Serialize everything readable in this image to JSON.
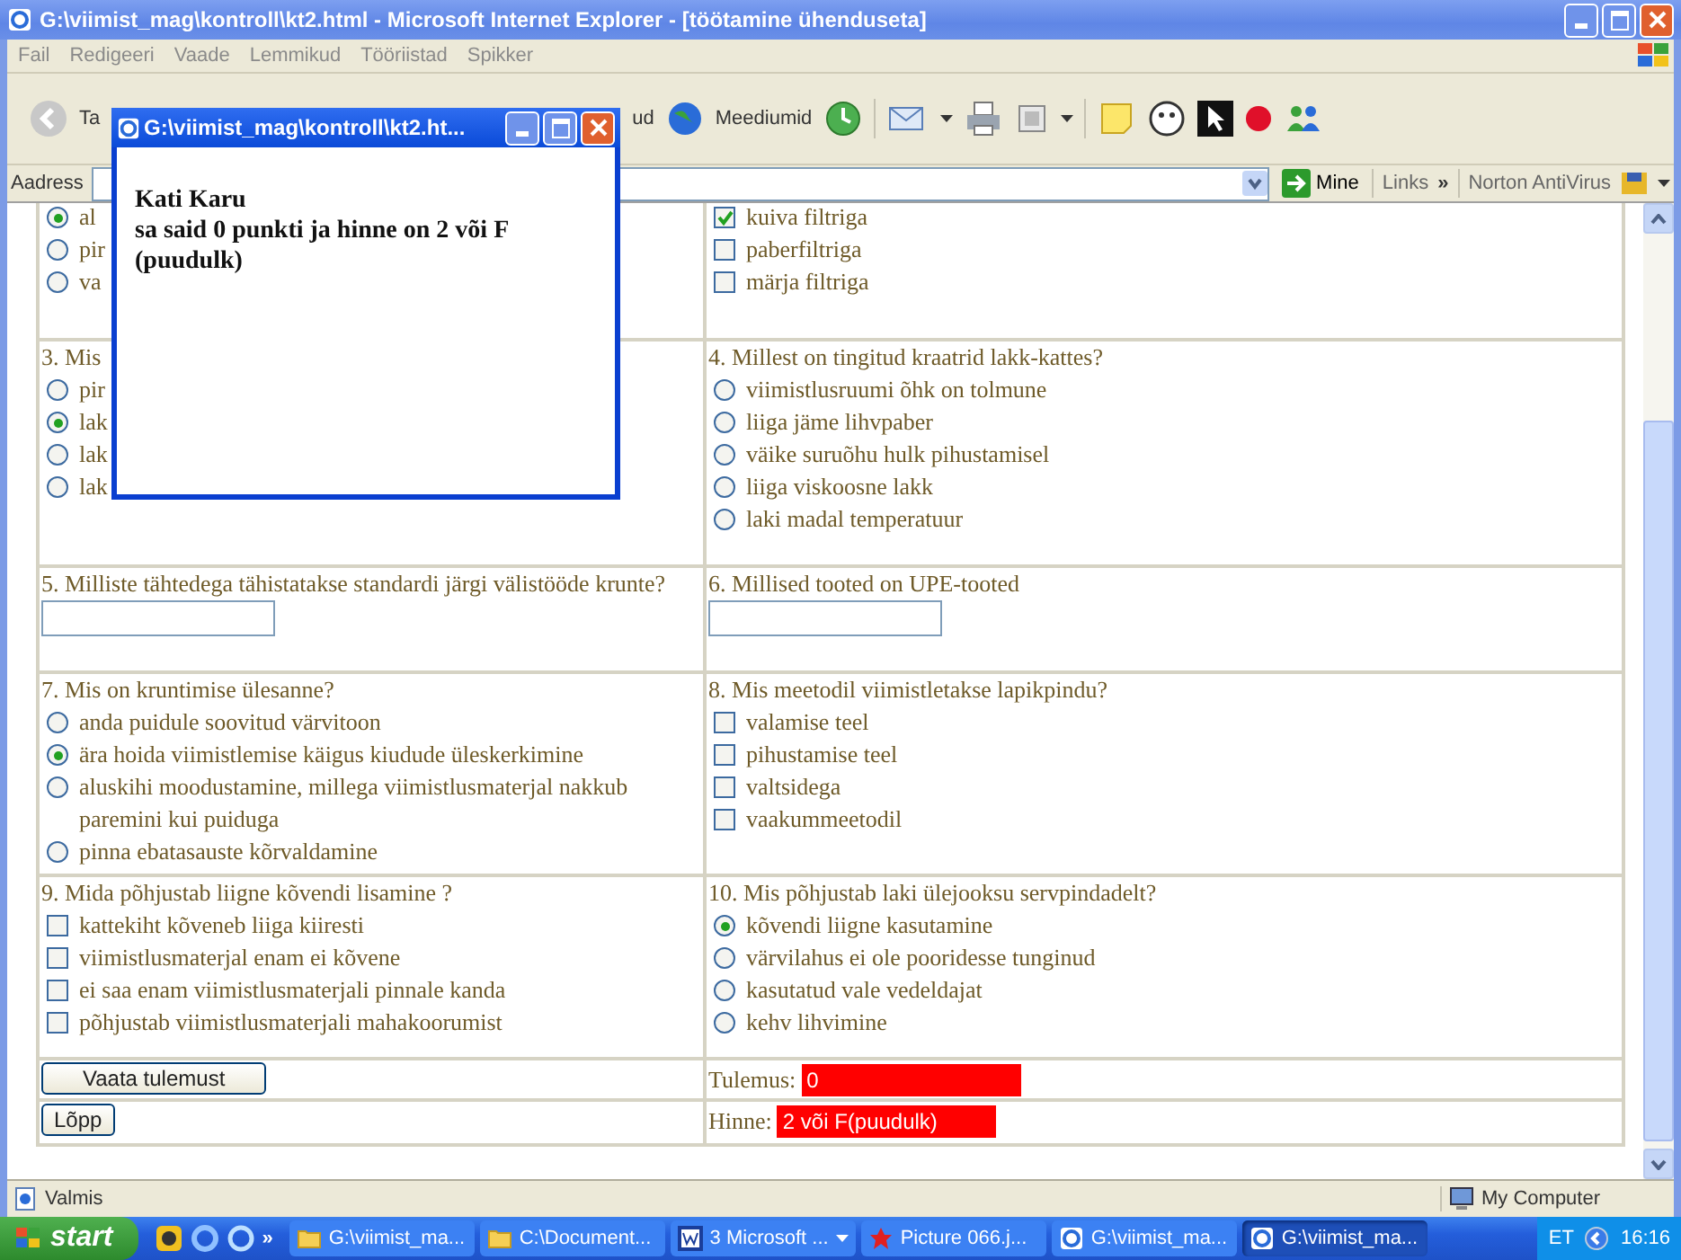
{
  "window": {
    "title": "G:\\viimist_mag\\kontroll\\kt2.html - Microsoft Internet Explorer - [töötamine ühenduseta]"
  },
  "menu": [
    "Fail",
    "Redigeeri",
    "Vaade",
    "Lemmikud",
    "Tööriistad",
    "Spikker"
  ],
  "toolbar": {
    "back_label": "Ta",
    "cut_label": "ud",
    "media_label": "Meediumid"
  },
  "address_bar": {
    "label": "Aadress",
    "go_label": "Mine",
    "links_label": "Links",
    "links_chevron": "»",
    "norton_label": "Norton AntiVirus"
  },
  "popup": {
    "title": "G:\\viimist_mag\\kontroll\\kt2.ht...",
    "name": "Kati Karu",
    "message_lines": [
      "sa said 0 punkti ja hinne on 2 või F",
      "(puudulk)"
    ]
  },
  "rows": [
    {
      "cells": [
        {
          "kind": "radio_group",
          "options": [
            {
              "label": "al",
              "selected": true
            },
            {
              "label": "pir",
              "selected": false
            },
            {
              "label": "va",
              "selected": false
            }
          ]
        },
        {
          "kind": "checkbox_group",
          "options": [
            {
              "label": "kuiva filtriga",
              "checked": true
            },
            {
              "label": "paberfiltriga",
              "checked": false
            },
            {
              "label": "märja filtriga",
              "checked": false
            }
          ]
        }
      ]
    },
    {
      "cells": [
        {
          "kind": "radio_group",
          "question": "3. Mis",
          "options": [
            {
              "label": "pir",
              "selected": false
            },
            {
              "label": "lak",
              "selected": true
            },
            {
              "label": "lak",
              "selected": false
            },
            {
              "label": "lak",
              "selected": false
            }
          ]
        },
        {
          "kind": "radio_group",
          "question": "4. Millest on tingitud kraatrid lakk-kattes?",
          "options": [
            {
              "label": "viimistlusruumi õhk on tolmune",
              "selected": false
            },
            {
              "label": "liiga jäme lihvpaber",
              "selected": false
            },
            {
              "label": "väike suruõhu hulk pihustamisel",
              "selected": false
            },
            {
              "label": "liiga viskoosne lakk",
              "selected": false
            },
            {
              "label": "laki madal temperatuur",
              "selected": false
            }
          ]
        }
      ]
    },
    {
      "cells": [
        {
          "kind": "text_field",
          "question": "5. Milliste tähtedega tähistatakse standardi järgi välistööde krunte?"
        },
        {
          "kind": "text_field",
          "question": "6. Millised tooted on UPE-tooted"
        }
      ]
    },
    {
      "cells": [
        {
          "kind": "radio_group",
          "question": "7. Mis on kruntimise ülesanne?",
          "options": [
            {
              "label": "anda puidule soovitud värvitoon",
              "selected": false
            },
            {
              "label": "ära hoida viimistlemise käigus kiudude üleskerkimine",
              "selected": true
            },
            {
              "label": "aluskihi moodustamine, millega viimistlusmaterjal nakkub paremini kui puiduga",
              "selected": false
            },
            {
              "label": "pinna ebatasauste kõrvaldamine",
              "selected": false
            }
          ]
        },
        {
          "kind": "checkbox_group",
          "question": "8. Mis meetodil viimistletakse lapikpindu?",
          "options": [
            {
              "label": "valamise teel",
              "checked": false
            },
            {
              "label": "pihustamise teel",
              "checked": false
            },
            {
              "label": "valtsidega",
              "checked": false
            },
            {
              "label": "vaakummeetodil",
              "checked": false
            }
          ]
        }
      ]
    },
    {
      "cells": [
        {
          "kind": "checkbox_group",
          "question": "9. Mida põhjustab liigne kõvendi lisamine ?",
          "options": [
            {
              "label": "kattekiht kõveneb liiga kiiresti",
              "checked": false
            },
            {
              "label": "viimistlusmaterjal enam ei kõvene",
              "checked": false
            },
            {
              "label": "ei saa enam viimistlusmaterjali pinnale kanda",
              "checked": false
            },
            {
              "label": "põhjustab viimistlusmaterjali mahakoorumist",
              "checked": false
            }
          ]
        },
        {
          "kind": "radio_group",
          "question": "10. Mis põhjustab laki ülejooksu servpindadelt?",
          "options": [
            {
              "label": "kõvendi liigne kasutamine",
              "selected": true
            },
            {
              "label": "värvilahus ei ole pooridesse tunginud",
              "selected": false
            },
            {
              "label": "kasutatud vale vedeldajat",
              "selected": false
            },
            {
              "label": "kehv lihvimine",
              "selected": false
            }
          ]
        }
      ]
    },
    {
      "cells": [
        {
          "kind": "button",
          "label": "Vaata tulemust"
        },
        {
          "kind": "result",
          "label": "Tulemus:",
          "value": "0"
        }
      ]
    },
    {
      "cells": [
        {
          "kind": "button",
          "label": "Lõpp"
        },
        {
          "kind": "result",
          "label": "Hinne:",
          "value": "2 või F(puudulk)"
        }
      ]
    }
  ],
  "status_bar": {
    "text": "Valmis",
    "zone": "My Computer"
  },
  "taskbar": {
    "start": "start",
    "chevron": "»",
    "language": "ET",
    "clock": "16:16",
    "buttons": [
      {
        "label": "G:\\viimist_ma...",
        "kind": "folder",
        "selected": false
      },
      {
        "label": "C:\\Document...",
        "kind": "folder",
        "selected": false
      },
      {
        "label": "3 Microsoft ...",
        "kind": "word",
        "selected": false
      },
      {
        "label": "Picture 066.j...",
        "kind": "picture",
        "selected": false
      },
      {
        "label": "G:\\viimist_ma...",
        "kind": "browser",
        "selected": false
      },
      {
        "label": "G:\\viimist_ma...",
        "kind": "browser",
        "selected": true
      }
    ]
  }
}
